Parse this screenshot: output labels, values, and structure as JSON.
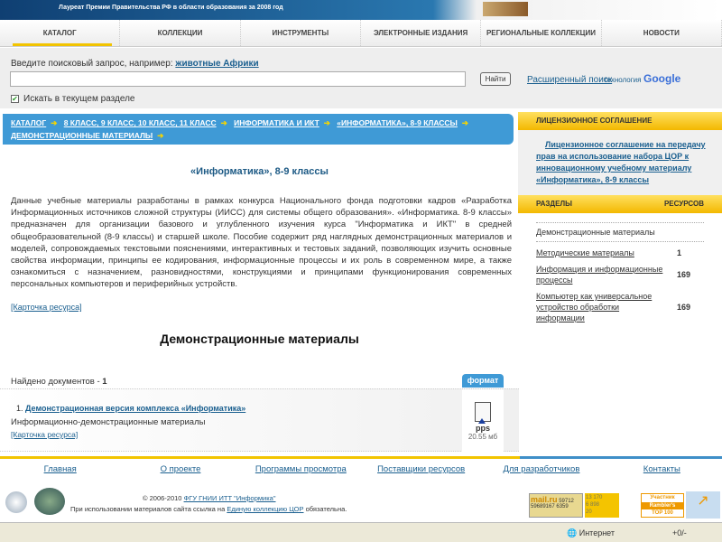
{
  "banner": {
    "text": "Лауреат Премии Правительства РФ в области образования за 2008 год"
  },
  "nav": [
    "КАТАЛОГ",
    "КОЛЛЕКЦИИ",
    "ИНСТРУМЕНТЫ",
    "ЭЛЕКТРОННЫЕ ИЗДАНИЯ",
    "РЕГИОНАЛЬНЫЕ КОЛЛЕКЦИИ",
    "НОВОСТИ"
  ],
  "search": {
    "hint": "Введите поисковый запрос, например:",
    "example": "животные Африки",
    "value": "",
    "button": "Найти",
    "advanced": "Расширенный поиск",
    "tech": "технология",
    "google": "Google",
    "checkbox": "Искать в текущем разделе"
  },
  "breadcrumb": [
    "КАТАЛОГ",
    "8 КЛАСС, 9 КЛАСС, 10 КЛАСС, 11 КЛАСС",
    "ИНФОРМАТИКА И ИКТ",
    "«ИНФОРМАТИКА», 8-9 КЛАССЫ",
    "ДЕМОНСТРАЦИОННЫЕ МАТЕРИАЛЫ"
  ],
  "main": {
    "title": "«Информатика», 8-9 классы",
    "description": "Данные учебные материалы разработаны в рамках конкурса Национального фонда подготовки кадров «Разработка Информационных источников сложной структуры (ИИСС) для системы общего образования». «Информатика. 8-9 классы» предназначен для организации базового и углубленного изучения курса \"Информатика и ИКТ\" в средней общеобразовательной (8-9 классы) и старшей школе. Пособие содержит ряд наглядных демонстрационных материалов и моделей, сопровождаемых текстовыми пояснениями, интерактивных и тестовых заданий, позволяющих изучить основные свойства информации, принципы ее кодирования, информационные процессы и их роль в современном мире, а также ознакомиться с назначением, разновидностями, конструкциями и принципами функционирования современных персональных компьютеров и периферийных устройств.",
    "card_link": "[Карточка ресурса]",
    "section_title": "Демонстрационные материалы",
    "found_label": "Найдено документов - ",
    "found_count": "1",
    "format_label": "формат",
    "result": {
      "num": "1.",
      "title": "Демонстрационная версия комплекса «Информатика»",
      "subtitle": "Информационно-демонстрационные материалы",
      "card": "[Карточка ресурса]",
      "ext": "pps",
      "size": "20.55 мб"
    }
  },
  "sidebar": {
    "license_header": "ЛИЦЕНЗИОННОЕ СОГЛАШЕНИЕ",
    "license_link": "Лицензионное соглашение на передачу прав на использование набора ЦОР к инновационному учебному материалу «Информатика», 8-9 классы",
    "sections_header": "РАЗДЕЛЫ",
    "resources_header": "РЕСУРСОВ",
    "current": "Демонстрационные материалы",
    "items": [
      {
        "label": "Методические материалы",
        "count": "1"
      },
      {
        "label": "Информация и информационные процессы",
        "count": "169"
      },
      {
        "label": "Компьютер как универсальное устройство обработки информации",
        "count": "169"
      }
    ]
  },
  "footer": {
    "links": [
      "Главная",
      "О проекте",
      "Программы просмотра ресурсов",
      "Поставщики ресурсов",
      "Для разработчиков",
      "Контакты"
    ],
    "copyright": "© 2006-2010 ",
    "org": "ФГУ ГНИИ ИТТ \"Информика\"",
    "note_pre": "При использовании материалов сайта ссылка на ",
    "note_link": "Единую коллекцию ЦОР",
    "note_post": " обязательна.",
    "counters": {
      "mail": "mail.ru",
      "mail_a": "59712",
      "mail_b": "59689167",
      "mail_c": "6359",
      "li": [
        "13 170",
        "6 898",
        "20"
      ],
      "rambler": [
        "Участник",
        "Rambler's",
        "TOP 100"
      ]
    }
  },
  "status": {
    "zone": "Интернет",
    "zoom": "+0/-"
  }
}
